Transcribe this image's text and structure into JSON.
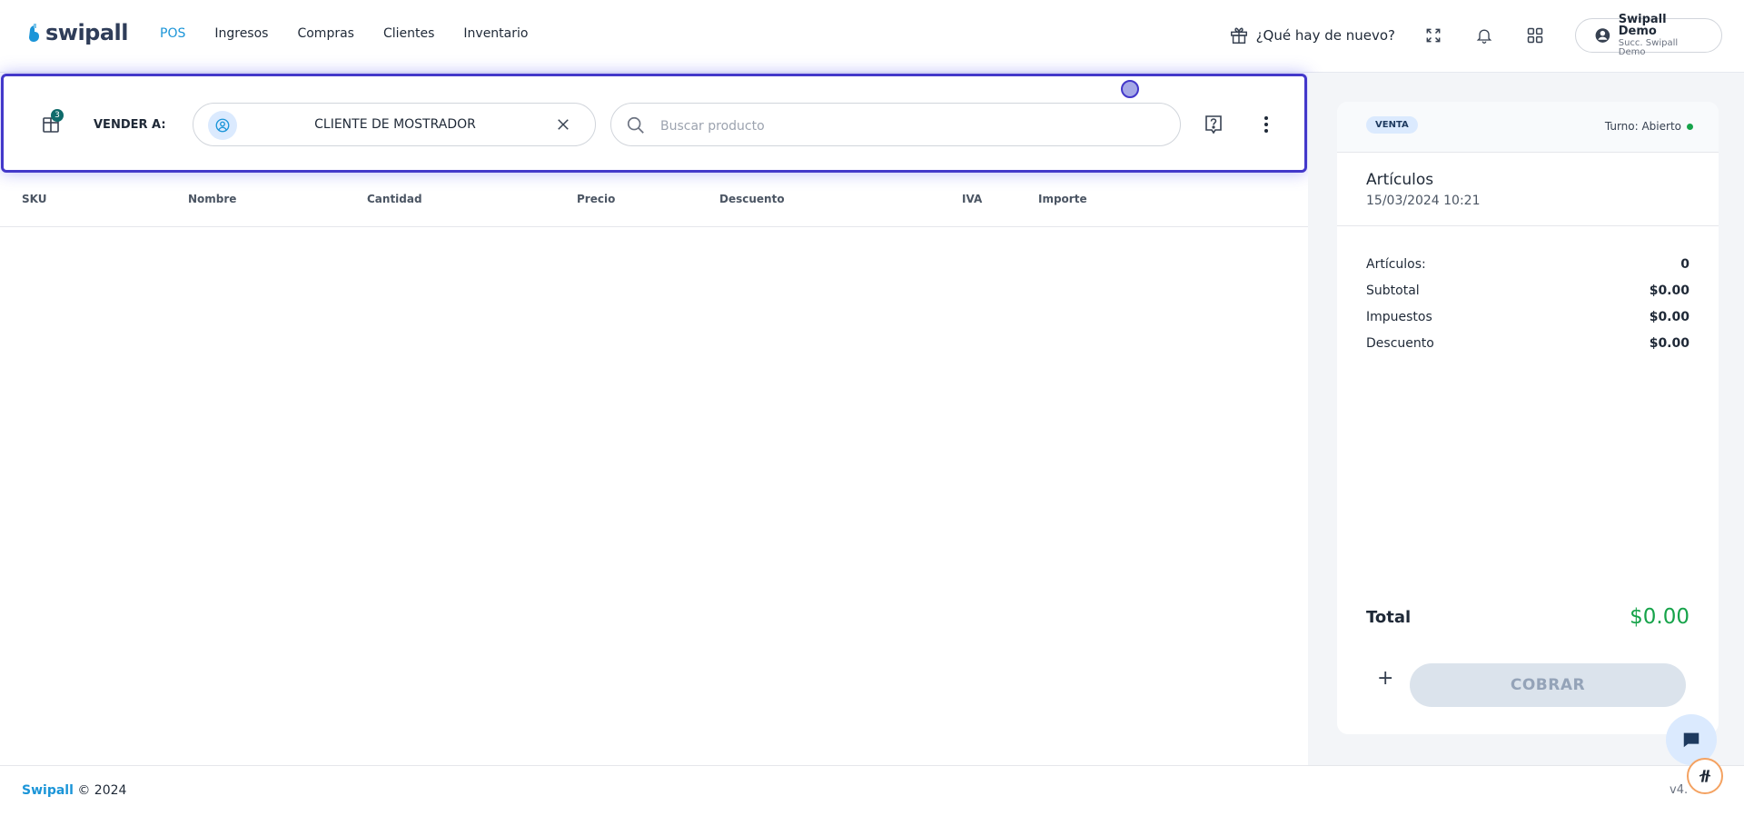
{
  "app": {
    "logo_text": "swipall",
    "nav": [
      {
        "label": "POS",
        "active": true
      },
      {
        "label": "Ingresos",
        "active": false
      },
      {
        "label": "Compras",
        "active": false
      },
      {
        "label": "Clientes",
        "active": false
      },
      {
        "label": "Inventario",
        "active": false
      }
    ],
    "whats_new": "¿Qué hay de nuevo?",
    "user": {
      "name": "Swipall Demo",
      "branch": "Succ. Swipall Demo"
    }
  },
  "pos_bar": {
    "cart_badge": "3",
    "sell_to_label": "VENDER A:",
    "client_name": "CLIENTE DE MOSTRADOR",
    "search_placeholder": "Buscar producto"
  },
  "table": {
    "columns": [
      "SKU",
      "Nombre",
      "Cantidad",
      "Precio",
      "Descuento",
      "IVA",
      "Importe"
    ],
    "rows": []
  },
  "summary": {
    "badge": "VENTA",
    "shift": "Turno: Abierto",
    "title": "Artículos",
    "date": "15/03/2024 10:21",
    "lines": [
      {
        "label": "Artículos:",
        "value": "0"
      },
      {
        "label": "Subtotal",
        "value": "$0.00"
      },
      {
        "label": "Impuestos",
        "value": "$0.00"
      },
      {
        "label": "Descuento",
        "value": "$0.00"
      }
    ],
    "total_label": "Total",
    "total_value": "$0.00",
    "charge_button": "COBRAR",
    "add_button": "+"
  },
  "footer": {
    "brand": "Swipall",
    "copyright": "© 2024",
    "version": "v4."
  },
  "colors": {
    "accent": "#1b95d8",
    "focus_border": "#4338ca",
    "total_green": "#16a34a"
  }
}
